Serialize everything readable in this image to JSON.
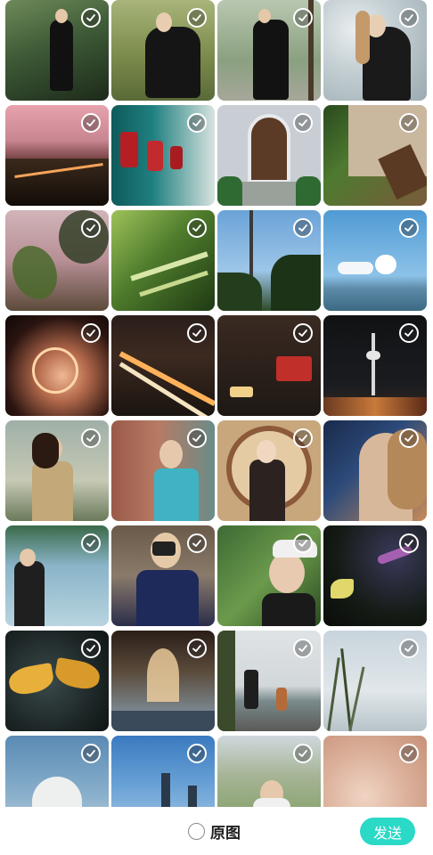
{
  "gallery": {
    "photos": [
      {
        "alt": "photo-1"
      },
      {
        "alt": "photo-2"
      },
      {
        "alt": "photo-3"
      },
      {
        "alt": "photo-4"
      },
      {
        "alt": "photo-5"
      },
      {
        "alt": "photo-6"
      },
      {
        "alt": "photo-7"
      },
      {
        "alt": "photo-8"
      },
      {
        "alt": "photo-9"
      },
      {
        "alt": "photo-10"
      },
      {
        "alt": "photo-11"
      },
      {
        "alt": "photo-12"
      },
      {
        "alt": "photo-13"
      },
      {
        "alt": "photo-14"
      },
      {
        "alt": "photo-15"
      },
      {
        "alt": "photo-16"
      },
      {
        "alt": "photo-17"
      },
      {
        "alt": "photo-18"
      },
      {
        "alt": "photo-19"
      },
      {
        "alt": "photo-20"
      },
      {
        "alt": "photo-21"
      },
      {
        "alt": "photo-22"
      },
      {
        "alt": "photo-23"
      },
      {
        "alt": "photo-24"
      },
      {
        "alt": "photo-25"
      },
      {
        "alt": "photo-26"
      },
      {
        "alt": "photo-27"
      },
      {
        "alt": "photo-28"
      },
      {
        "alt": "photo-29"
      },
      {
        "alt": "photo-30"
      },
      {
        "alt": "photo-31"
      },
      {
        "alt": "photo-32"
      }
    ],
    "check_icon": "check-icon"
  },
  "bottom_bar": {
    "original_label": "原图",
    "send_label": "发送",
    "accent_color": "#2bd9c7"
  }
}
